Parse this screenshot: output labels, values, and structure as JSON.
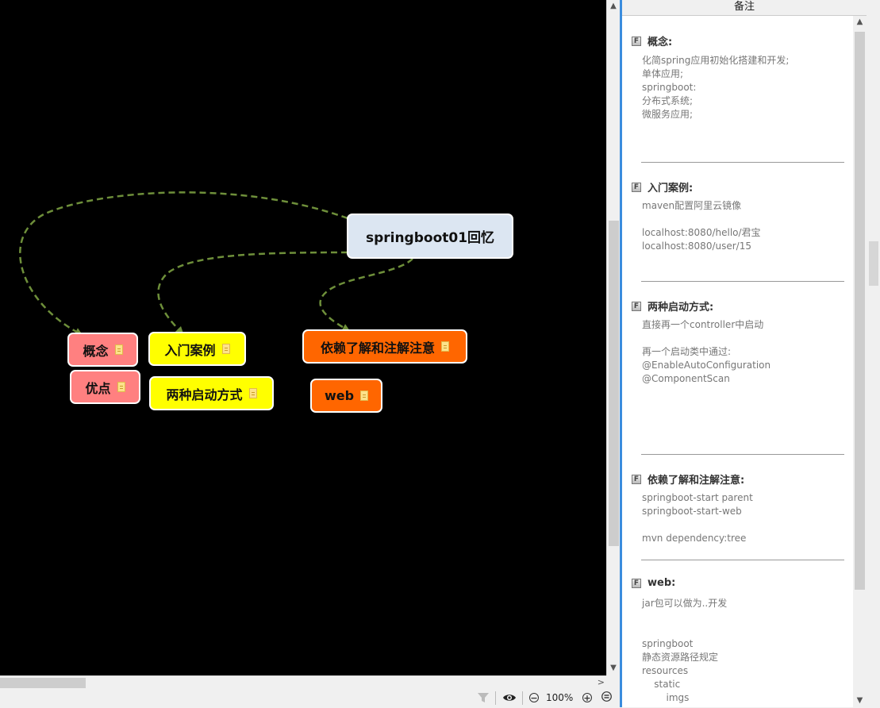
{
  "mindmap": {
    "root": "springboot01回忆",
    "nodes": [
      {
        "id": "gainian",
        "label": "概念"
      },
      {
        "id": "youdian",
        "label": "优点"
      },
      {
        "id": "rumen",
        "label": "入门案例"
      },
      {
        "id": "qidong",
        "label": "两种启动方式"
      },
      {
        "id": "yilai",
        "label": "依赖了解和注解注意"
      },
      {
        "id": "web",
        "label": "web"
      }
    ],
    "link_color": "#6e8f3a"
  },
  "statusbar": {
    "zoom": "100%",
    "minus": "−",
    "plus": "+",
    "icons": [
      "filter-icon",
      "eye-icon",
      "zoom-out-icon",
      "zoom-in-icon",
      "menu-icon"
    ]
  },
  "notes": {
    "title": "备注",
    "sections": [
      {
        "title": "概念:",
        "lines": [
          "化简spring应用初始化搭建和开发;",
          "单体应用;",
          "springboot:",
          "分布式系统;",
          "微服务应用;"
        ]
      },
      {
        "title": "入门案例:",
        "lines": [
          "maven配置阿里云镜像",
          "",
          "localhost:8080/hello/君宝",
          "localhost:8080/user/15"
        ]
      },
      {
        "title": "两种启动方式:",
        "lines": [
          "直接再一个controller中启动",
          "",
          "再一个启动类中通过:",
          "@EnableAutoConfiguration",
          "@ComponentScan"
        ]
      },
      {
        "title": "依赖了解和注解注意:",
        "lines": [
          "springboot-start parent",
          "springboot-start-web",
          "",
          "mvn dependency:tree"
        ]
      },
      {
        "title": "web:",
        "lines": [
          "jar包可以做为..开发",
          "",
          "",
          "springboot",
          "静态资源路径规定",
          "resources",
          "    static",
          "        imgs"
        ]
      }
    ]
  }
}
